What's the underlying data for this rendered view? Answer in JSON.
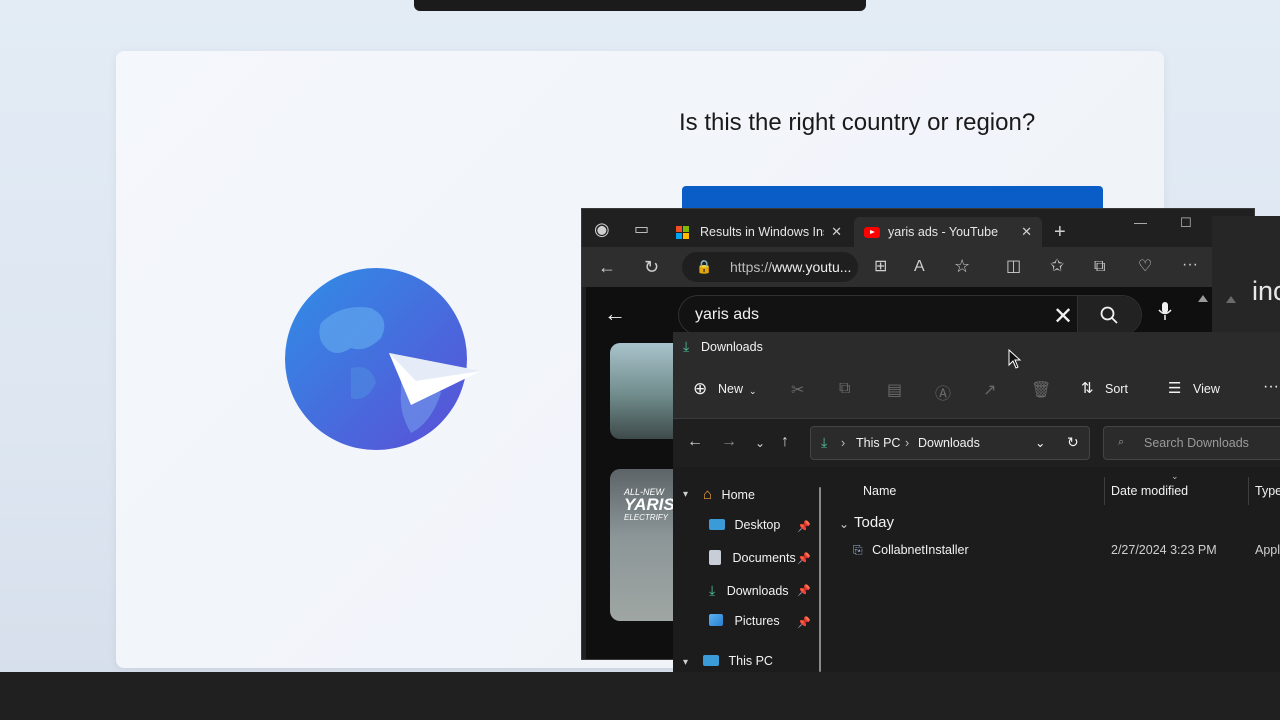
{
  "oobe": {
    "title": "Is this the right country or region?"
  },
  "edge": {
    "tabs": [
      {
        "label": "Results in Windows Insi",
        "icon": "microsoft-logo"
      },
      {
        "label": "yaris ads - YouTube",
        "icon": "youtube-logo"
      }
    ],
    "close_glyph": "✕",
    "new_tab_glyph": "+",
    "window_controls": [
      "—",
      "☐",
      "✕"
    ],
    "address": {
      "prefix": "https://",
      "host": "www.youtu..."
    },
    "youtube": {
      "search_query": "yaris ads",
      "thumb2_text": [
        "ALL-NEW",
        "YARIS",
        "ELECTRIFY"
      ]
    }
  },
  "side_window": {
    "text": "inc"
  },
  "explorer": {
    "title": "Downloads",
    "commands": {
      "new": "New",
      "sort": "Sort",
      "view": "View",
      "more": "···"
    },
    "breadcrumb": [
      "This PC",
      "Downloads"
    ],
    "search_placeholder": "Search Downloads",
    "nav": [
      {
        "label": "Home",
        "icon": "home-icon"
      },
      {
        "label": "Desktop",
        "icon": "desktop-icon",
        "pinned": true
      },
      {
        "label": "Documents",
        "icon": "documents-icon",
        "pinned": true
      },
      {
        "label": "Downloads",
        "icon": "downloads-icon",
        "pinned": true
      },
      {
        "label": "Pictures",
        "icon": "pictures-icon",
        "pinned": true
      },
      {
        "label": "This PC",
        "icon": "this-pc-icon"
      }
    ],
    "columns": [
      "Name",
      "Date modified",
      "Type"
    ],
    "group": "Today",
    "files": [
      {
        "name": "CollabnetInstaller",
        "date": "2/27/2024 3:23 PM",
        "type": "Appl"
      }
    ]
  },
  "colors": {
    "accent": "#0a5cc7",
    "dark_bg": "#202020",
    "download_green": "#4fc3a0"
  }
}
